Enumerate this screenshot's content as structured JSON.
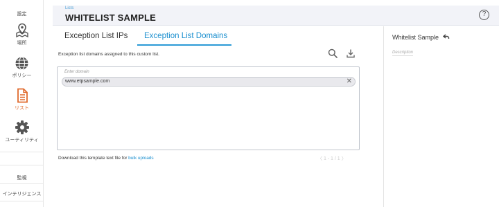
{
  "nav": {
    "top_label": "設定",
    "items": [
      {
        "label": "場所",
        "icon": "location-map-icon"
      },
      {
        "label": "ポリシー",
        "icon": "globe-icon"
      },
      {
        "label": "リスト",
        "icon": "document-list-icon",
        "active": true
      },
      {
        "label": "ユーティリティ",
        "icon": "gear-icon"
      }
    ],
    "bottom_items": [
      {
        "label": "監視"
      },
      {
        "label": "インテリジェンス"
      }
    ]
  },
  "header": {
    "breadcrumb": "Lists",
    "title": "WHITELIST SAMPLE",
    "help_icon": "help-circle-icon",
    "help_glyph": "?"
  },
  "tabs": [
    {
      "label": "Exception List IPs",
      "active": false
    },
    {
      "label": "Exception List Domains",
      "active": true
    }
  ],
  "main": {
    "description": "Exception list domains assigned to this custom list.",
    "search_icon": "search-icon",
    "download_icon": "download-icon",
    "input_placeholder": "Enter domain",
    "domains": [
      "www.etpsample.com"
    ],
    "remove_glyph": "✕",
    "template_text": "Download this template text file for ",
    "template_link": "bulk uploads",
    "pager": "〈 1 - 1 / 1 〉"
  },
  "side": {
    "title": "Whitelist Sample",
    "undo_icon": "undo-arrow-icon",
    "description_placeholder": "Description"
  },
  "colors": {
    "accent": "#1b8fcf",
    "active_nav": "#e06a2c",
    "header_bg": "#f2f3f8"
  }
}
